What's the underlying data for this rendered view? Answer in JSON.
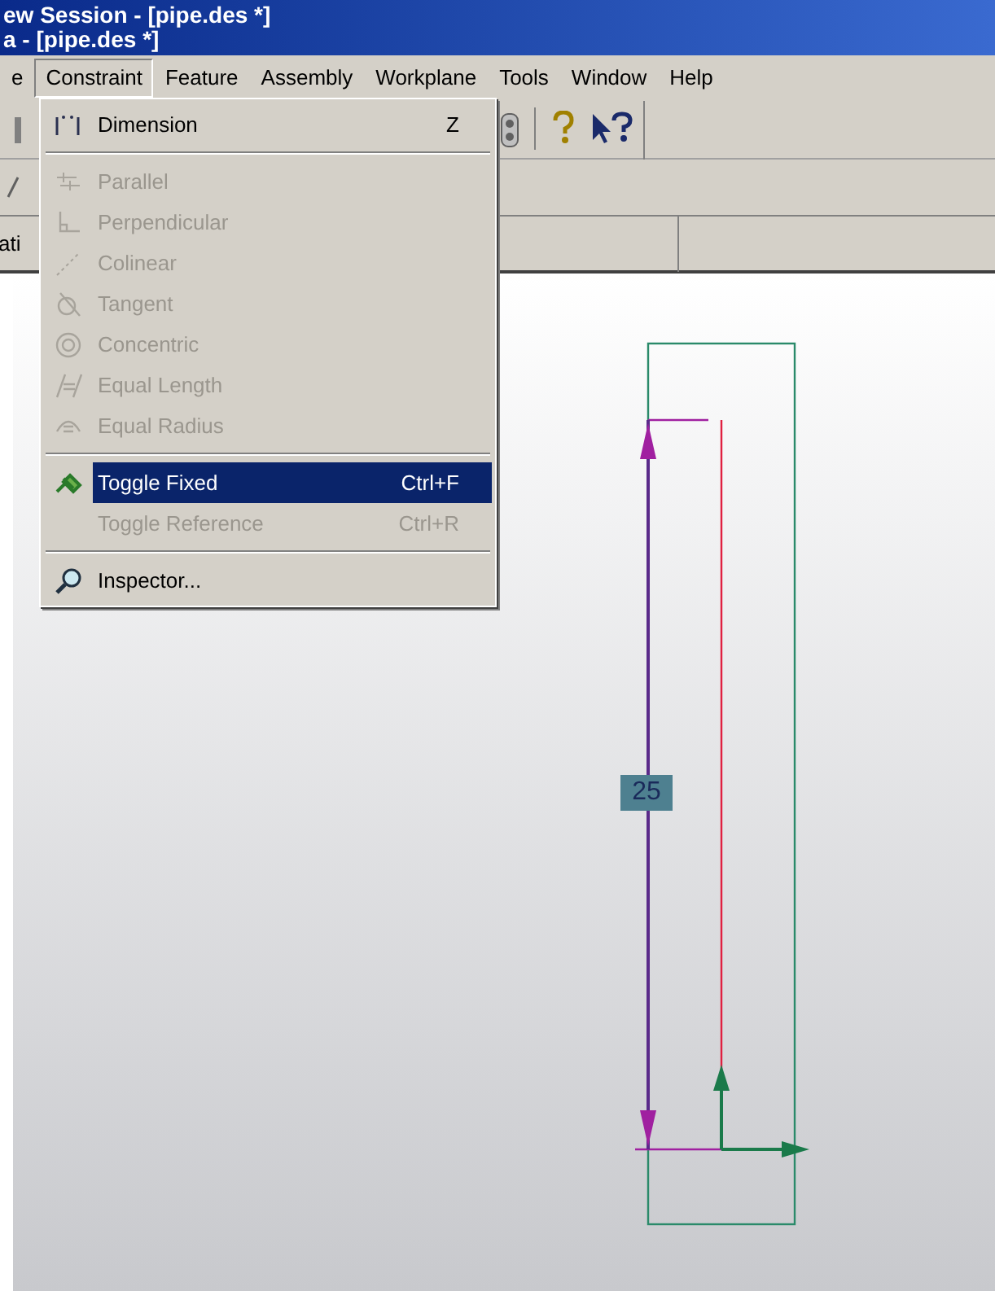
{
  "title_bar": {
    "lines": [
      "ew Session - [pipe.des *]",
      "a - [pipe.des *]"
    ]
  },
  "menu_bar": [
    {
      "label": "e",
      "selected": false
    },
    {
      "label": "Constraint",
      "selected": true
    },
    {
      "label": "Feature",
      "selected": false
    },
    {
      "label": "Assembly",
      "selected": false
    },
    {
      "label": "Workplane",
      "selected": false
    },
    {
      "label": "Tools",
      "selected": false
    },
    {
      "label": "Window",
      "selected": false
    },
    {
      "label": "Help",
      "selected": false
    }
  ],
  "panel_tab": "ati",
  "constraint_menu": [
    {
      "kind": "command",
      "label": "Dimension",
      "shortcut": "Z",
      "disabled": false,
      "selected": false
    },
    {
      "kind": "separator"
    },
    {
      "kind": "command",
      "label": "Parallel",
      "disabled": true,
      "selected": false
    },
    {
      "kind": "command",
      "label": "Perpendicular",
      "disabled": true,
      "selected": false
    },
    {
      "kind": "command",
      "label": "Colinear",
      "disabled": true,
      "selected": false
    },
    {
      "kind": "command",
      "label": "Tangent",
      "disabled": true,
      "selected": false
    },
    {
      "kind": "command",
      "label": "Concentric",
      "disabled": true,
      "selected": false
    },
    {
      "kind": "command",
      "label": "Equal Length",
      "disabled": true,
      "selected": false
    },
    {
      "kind": "command",
      "label": "Equal Radius",
      "disabled": true,
      "selected": false
    },
    {
      "kind": "separator"
    },
    {
      "kind": "command",
      "label": "Toggle Fixed",
      "shortcut": "Ctrl+F",
      "disabled": false,
      "selected": true
    },
    {
      "kind": "command",
      "label": "Toggle Reference",
      "shortcut": "Ctrl+R",
      "disabled": true,
      "selected": false
    },
    {
      "kind": "separator"
    },
    {
      "kind": "command",
      "label": "Inspector...",
      "disabled": false,
      "selected": false
    }
  ],
  "sketch": {
    "dimension": "25"
  }
}
